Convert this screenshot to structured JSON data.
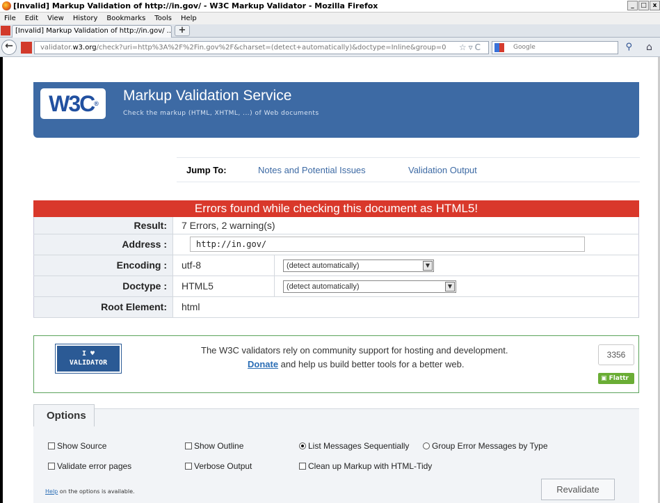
{
  "window": {
    "title": "[Invalid] Markup Validation of http://in.gov/ - W3C Markup Validator - Mozilla Firefox",
    "controls": [
      "_",
      "□",
      "x"
    ]
  },
  "menu": [
    "File",
    "Edit",
    "View",
    "History",
    "Bookmarks",
    "Tools",
    "Help"
  ],
  "tab": {
    "label": "[Invalid] Markup Validation of http://in.gov/ ...",
    "new_tab": "+"
  },
  "nav": {
    "url_prefix": "validator.",
    "url_domain": "w3.org",
    "url_rest": "/check?uri=http%3A%2F%2Fin.gov%2F&charset=(detect+automatically)&doctype=Inline&group=0",
    "search_placeholder": "Google"
  },
  "banner": {
    "logo": "W3C",
    "title": "Markup Validation Service",
    "subtitle": "Check the markup (HTML, XHTML, ...) of Web documents"
  },
  "jump": {
    "label": "Jump To:",
    "links": [
      "Notes and Potential Issues",
      "Validation Output"
    ]
  },
  "result": {
    "heading": "Errors found while checking this document as HTML5!",
    "result_label": "Result:",
    "result_value": "7 Errors, 2 warning(s)",
    "address_label": "Address :",
    "address_value": "http://in.gov/",
    "encoding_label": "Encoding :",
    "encoding_value": "utf-8",
    "encoding_select": "(detect automatically)",
    "doctype_label": "Doctype :",
    "doctype_value": "HTML5",
    "doctype_select": "(detect automatically)",
    "root_label": "Root Element:",
    "root_value": "html"
  },
  "donate": {
    "badge_top": "I ♥",
    "badge_bottom": "VALIDATOR",
    "line1": "The W3C validators rely on community support for hosting and development.",
    "link": "Donate",
    "line2_rest": " and help us build better tools for a better web.",
    "flattr_count": "3356",
    "flattr_label": "Flattr"
  },
  "options": {
    "title": "Options",
    "show_source": "Show Source",
    "show_outline": "Show Outline",
    "list_sequential": "List Messages Sequentially",
    "group_by_type": "Group Error Messages by Type",
    "validate_error_pages": "Validate error pages",
    "verbose_output": "Verbose Output",
    "cleanup_tidy": "Clean up Markup with HTML-Tidy",
    "help_link": "Help",
    "help_rest": " on the options is available.",
    "revalidate": "Revalidate"
  },
  "colors": {
    "error_red": "#d9382b",
    "w3c_blue": "#3d6aa4",
    "donate_green": "#5ba35b"
  }
}
